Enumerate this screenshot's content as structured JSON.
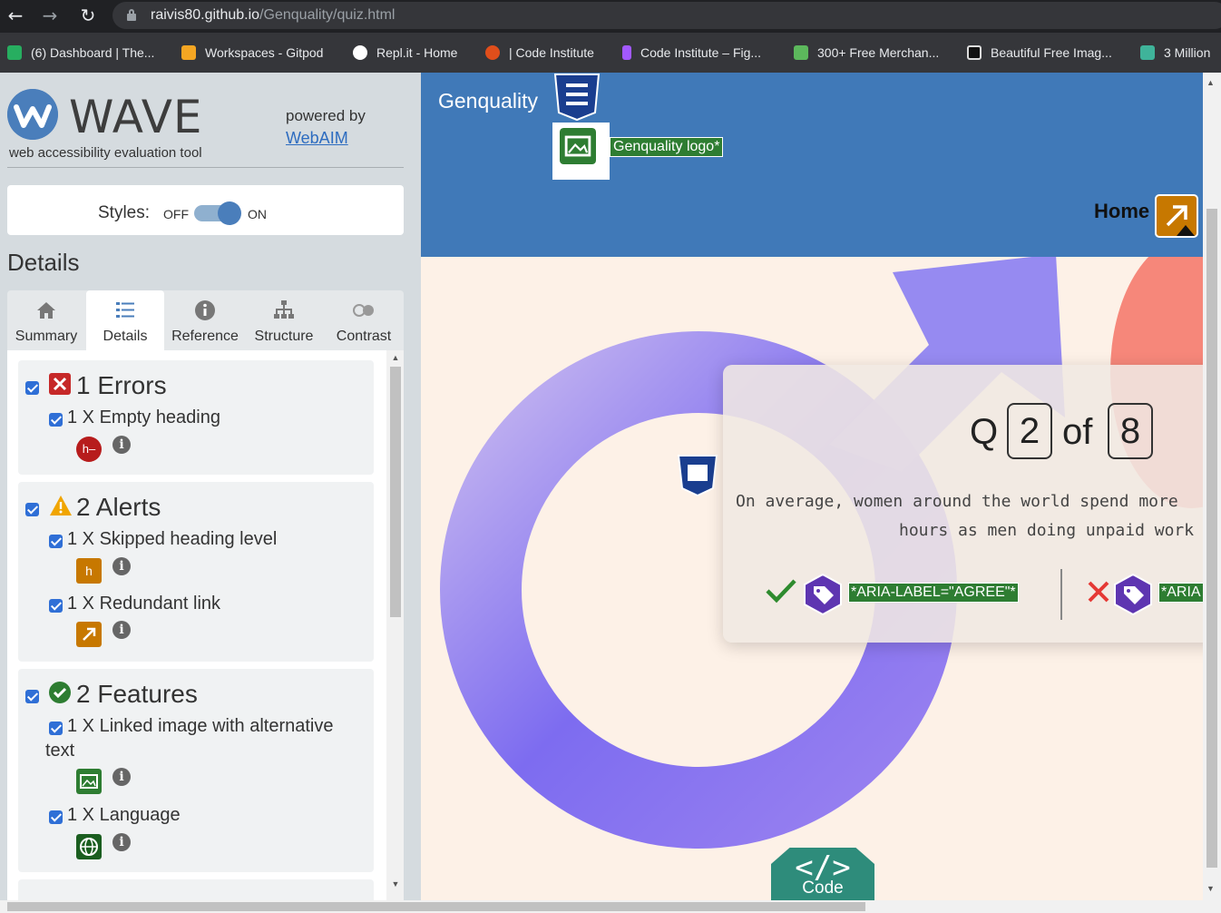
{
  "browser": {
    "url_host": "raivis80.github.io",
    "url_path": "/Genquality/quiz.html",
    "bookmarks": [
      {
        "label": "(6) Dashboard | The...",
        "color": "#27ae60"
      },
      {
        "label": "Workspaces - Gitpod",
        "color": "#f5a623"
      },
      {
        "label": "Repl.it - Home",
        "color": "#ffffff"
      },
      {
        "label": "| Code Institute",
        "color": "#e04e1b"
      },
      {
        "label": "Code Institute – Fig...",
        "color": "#a259ff"
      },
      {
        "label": "300+ Free Merchan...",
        "color": "#5cb85c"
      },
      {
        "label": "Beautiful Free Imag...",
        "color": "#111111"
      },
      {
        "label": "3 Million",
        "color": "#3fb39a"
      }
    ]
  },
  "wave": {
    "title": "WAVE",
    "subtitle": "web accessibility evaluation tool",
    "powered_by": "powered by",
    "webaim": "WebAIM",
    "styles_label": "Styles:",
    "off": "OFF",
    "on": "ON",
    "details_heading": "Details",
    "tabs": [
      {
        "label": "Summary",
        "icon": "home-icon"
      },
      {
        "label": "Details",
        "icon": "list-icon"
      },
      {
        "label": "Reference",
        "icon": "info-icon"
      },
      {
        "label": "Structure",
        "icon": "structure-icon"
      },
      {
        "label": "Contrast",
        "icon": "contrast-icon"
      }
    ],
    "errors": {
      "title": "1 Errors",
      "items": [
        {
          "text": "1 X Empty heading"
        }
      ]
    },
    "alerts": {
      "title": "2 Alerts",
      "items": [
        {
          "text": "1 X Skipped heading level"
        },
        {
          "text": "1 X Redundant link"
        }
      ]
    },
    "features": {
      "title": "2 Features",
      "items": [
        {
          "text": "1 X Linked image with alternative text"
        },
        {
          "text": "1 X Language"
        }
      ]
    },
    "badges": {
      "empty_heading": "h–",
      "skipped_heading": "h"
    }
  },
  "page": {
    "brand": "Genquality",
    "logo_alt": "Genquality logo*",
    "home": "Home",
    "q_prefix": "Q",
    "q_current": "2",
    "q_of": "of",
    "q_total": "8",
    "question_line1": "On average, women around the world spend more",
    "question_line2": "hours as men doing unpaid work",
    "agree_aria": "*ARIA-LABEL=\"AGREE\"*",
    "disagree_aria": "*ARIA",
    "code_symbol": "</>",
    "code_label": "Code"
  },
  "colors": {
    "header": "#4079b8",
    "accent": "#4a7ebb",
    "error": "#c62828",
    "alert": "#f0a500",
    "feature": "#2e7d32",
    "circle": "#7b6cf0"
  }
}
